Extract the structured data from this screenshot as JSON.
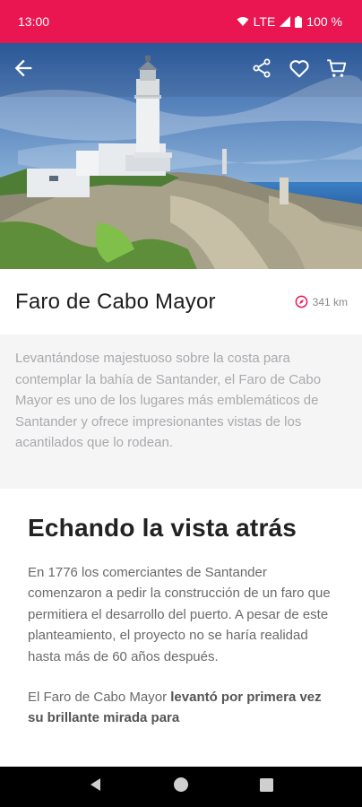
{
  "status": {
    "time": "13:00",
    "network": "LTE",
    "battery": "100 %"
  },
  "hero": {
    "image_alt": "Faro de Cabo Mayor lighthouse on the cliffs"
  },
  "place": {
    "title": "Faro de Cabo Mayor",
    "distance": "341 km"
  },
  "intro_text": "Levantándose majestuoso sobre la costa para contemplar la bahía de Santander, el Faro de Cabo Mayor es  uno de los lugares más emblemáticos de Santander  y ofrece impresionantes vistas de los acantilados  que lo rodean.",
  "section": {
    "title": "Echando la vista atrás",
    "para1": "En 1776 los comerciantes de Santander comenzaron a pedir la construcción de un faro que permitiera el desarrollo del puerto. A pesar de este planteamiento, el proyecto no se haría realidad hasta más de 60 años después.",
    "para2_prefix": "El Faro de Cabo Mayor ",
    "para2_bold": "levantó por primera vez su brillante mirada para"
  },
  "colors": {
    "accent": "#ea1652"
  }
}
